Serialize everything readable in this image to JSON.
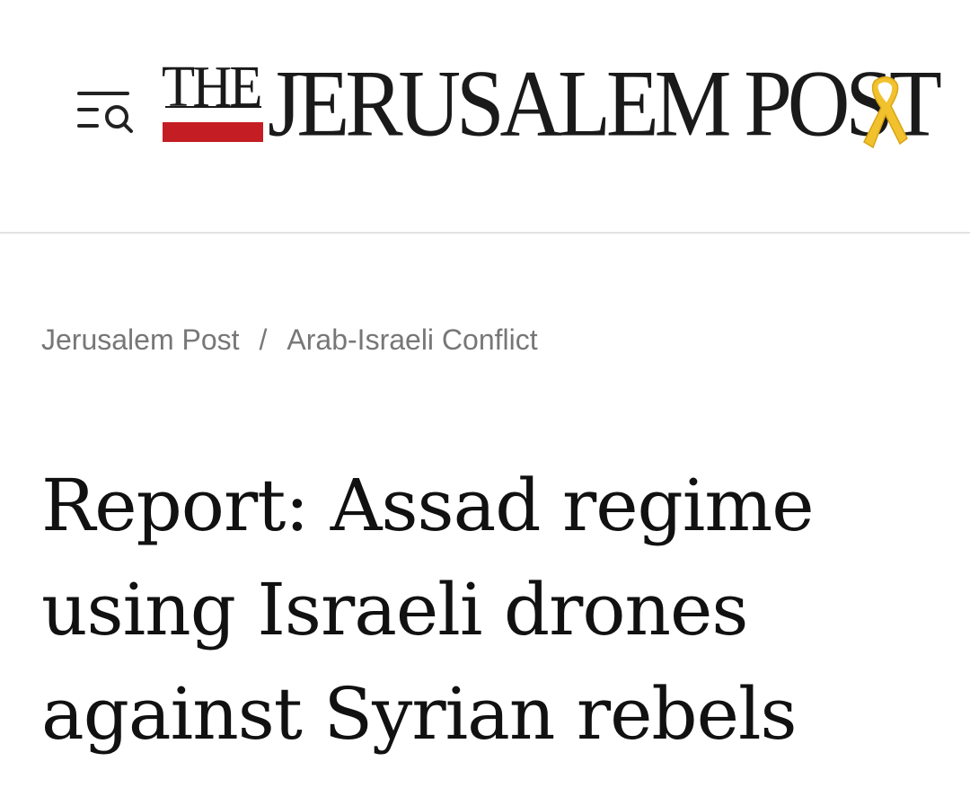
{
  "header": {
    "menu_search_icon": "menu-search-icon",
    "logo": {
      "the": "THE",
      "name": "JERUSALEM POST",
      "ribbon_icon": "yellow-ribbon-icon",
      "accent_color": "#c41e24",
      "ribbon_color": "#f2c12e"
    }
  },
  "breadcrumb": {
    "items": [
      "Jerusalem Post",
      "Arab-Israeli Conflict"
    ],
    "separator": "/"
  },
  "article": {
    "headline": "Report: Assad regime using Israeli drones against Syrian rebels"
  }
}
